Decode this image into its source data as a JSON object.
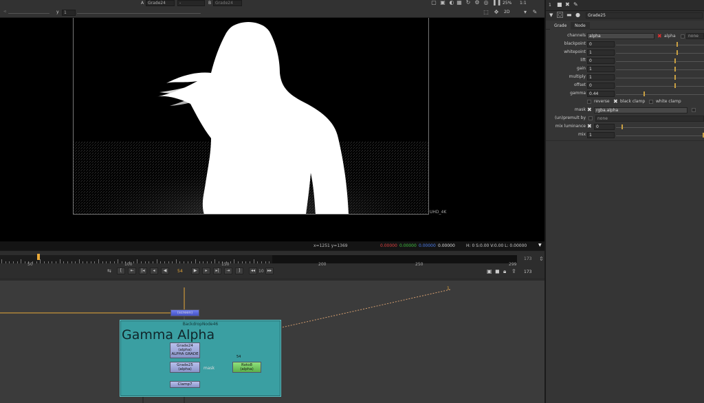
{
  "viewer": {
    "a_label": "A",
    "a_input": "Grade24",
    "a_op": "-",
    "b_label": "B",
    "b_input": "Grade24",
    "y_label": "y",
    "y_value": "1",
    "zoom": "25%",
    "scale": "1:1",
    "view_mode": "2D",
    "format": "UHD_4K",
    "info_coords": "x=1251 y=1369",
    "info_r": "0.00000",
    "info_g": "0.00000",
    "info_b": "0.00000",
    "info_a": "0.00000",
    "info_hsv": "H:   0 S:0.00 V:0.00  L: 0.00000",
    "colors": {
      "r": "#e04040",
      "g": "#40c040",
      "b": "#4d7ff0"
    }
  },
  "timeline": {
    "ticks": [
      "50",
      "100",
      "150",
      "200",
      "250",
      "299"
    ],
    "current_frame": "54",
    "end_frame": "173",
    "end_frame2": "173",
    "step": "10",
    "playhead_marker": "54"
  },
  "node_graph": {
    "backdrop_title": "BackdropNode46",
    "backdrop_label": "Gamma Alpha",
    "top_node": "(screen)",
    "nodes": [
      {
        "label": "Grade24",
        "sub": "(alpha)",
        "extra": "ALPHA GRADE"
      },
      {
        "label": "Grade25",
        "sub": "(alpha)"
      },
      {
        "label": "Clamp7"
      },
      {
        "label": "Roto8",
        "sub": "(alpha)"
      }
    ],
    "mask_label": "mask",
    "roto_frame": "54",
    "far_marker": "1"
  },
  "properties": {
    "node_name": "Grade25",
    "tabs": [
      "Grade",
      "Node"
    ],
    "channels_label": "channels",
    "channels_value": "alpha",
    "alpha_label": "alpha",
    "none_label": "none",
    "rows": [
      {
        "label": "blackpoint",
        "value": "0"
      },
      {
        "label": "whitepoint",
        "value": "1"
      },
      {
        "label": "lift",
        "value": "0"
      },
      {
        "label": "gain",
        "value": "1"
      },
      {
        "label": "multiply",
        "value": "1"
      },
      {
        "label": "offset",
        "value": "0"
      },
      {
        "label": "gamma",
        "value": "0.44"
      }
    ],
    "reverse": "reverse",
    "black_clamp": "black clamp",
    "white_clamp": "white clamp",
    "mask_label": "mask",
    "mask_value": "rgba.alpha",
    "premult_label": "(un)premult by",
    "premult_value": "none",
    "mixlum_label": "mix luminance",
    "mixlum_value": "0",
    "mix_label": "mix",
    "mix_value": "1",
    "panel_index": "1"
  }
}
